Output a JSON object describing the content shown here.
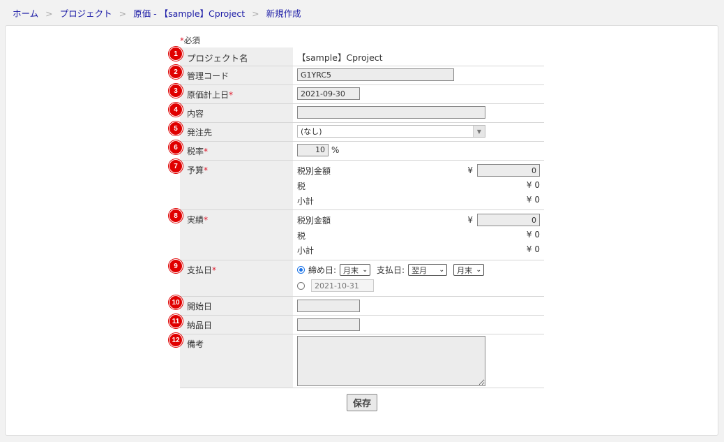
{
  "breadcrumb": [
    {
      "label": "ホーム"
    },
    {
      "label": "プロジェクト"
    },
    {
      "label": "原価 - 【sample】Cproject"
    },
    {
      "label": "新規作成"
    }
  ],
  "breadcrumb_sep": ">",
  "required_note": {
    "star": "*",
    "text": "必須"
  },
  "fields": {
    "project_name": {
      "num": "1",
      "label": "プロジェクト名",
      "value": "【sample】Cproject"
    },
    "management_code": {
      "num": "2",
      "label": "管理コード",
      "value": "G1YRC5"
    },
    "cost_date": {
      "num": "3",
      "label": "原価計上日",
      "required": "*",
      "value": "2021-09-30"
    },
    "content": {
      "num": "4",
      "label": "内容",
      "value": ""
    },
    "supplier": {
      "num": "5",
      "label": "発注先",
      "selected": "(なし)"
    },
    "tax_rate": {
      "num": "6",
      "label": "税率",
      "required": "*",
      "value": "10",
      "unit": "%"
    },
    "budget": {
      "num": "7",
      "label": "予算",
      "required": "*",
      "pretax_label": "税別金額",
      "yen": "¥",
      "pretax_value": "0",
      "tax_label": "税",
      "tax_value": "¥ 0",
      "subtotal_label": "小計",
      "subtotal_value": "¥ 0"
    },
    "actual": {
      "num": "8",
      "label": "実績",
      "required": "*",
      "pretax_label": "税別金額",
      "yen": "¥",
      "pretax_value": "0",
      "tax_label": "税",
      "tax_value": "¥ 0",
      "subtotal_label": "小計",
      "subtotal_value": "¥ 0"
    },
    "payment_date": {
      "num": "9",
      "label": "支払日",
      "required": "*",
      "closing_label": "締め日:",
      "closing_value": "月末",
      "pay_label": "支払日:",
      "pay_month": "翌月",
      "pay_day": "月末",
      "fixed_date_placeholder": "2021-10-31"
    },
    "start_date": {
      "num": "10",
      "label": "開始日",
      "value": ""
    },
    "delivery_date": {
      "num": "11",
      "label": "納品日",
      "value": ""
    },
    "remarks": {
      "num": "12",
      "label": "備考",
      "value": ""
    }
  },
  "save_label": "保存"
}
